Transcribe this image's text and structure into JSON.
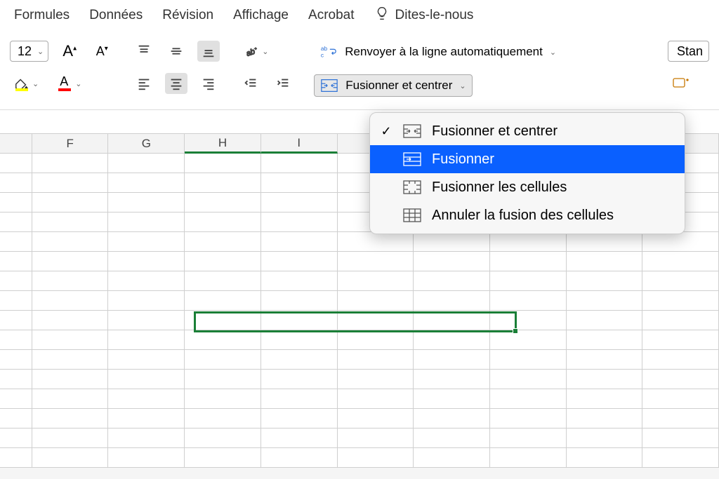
{
  "menubar": {
    "items": [
      "Formules",
      "Données",
      "Révision",
      "Affichage",
      "Acrobat"
    ],
    "tellme": "Dites-le-nous"
  },
  "ribbon": {
    "fontSize": "12",
    "wrapText": "Renvoyer à la ligne automatiquement",
    "mergeCenter": "Fusionner et centrer",
    "numberFormat": "Stan"
  },
  "columns": [
    "F",
    "G",
    "H",
    "I",
    "",
    "",
    "",
    "",
    "",
    ""
  ],
  "dropdown": {
    "items": [
      {
        "label": "Fusionner et centrer",
        "checked": true,
        "highlighted": false,
        "iconType": "merge-center"
      },
      {
        "label": "Fusionner",
        "checked": false,
        "highlighted": true,
        "iconType": "merge-across"
      },
      {
        "label": "Fusionner les cellules",
        "checked": false,
        "highlighted": false,
        "iconType": "merge-cells"
      },
      {
        "label": "Annuler la fusion des cellules",
        "checked": false,
        "highlighted": false,
        "iconType": "unmerge"
      }
    ]
  }
}
